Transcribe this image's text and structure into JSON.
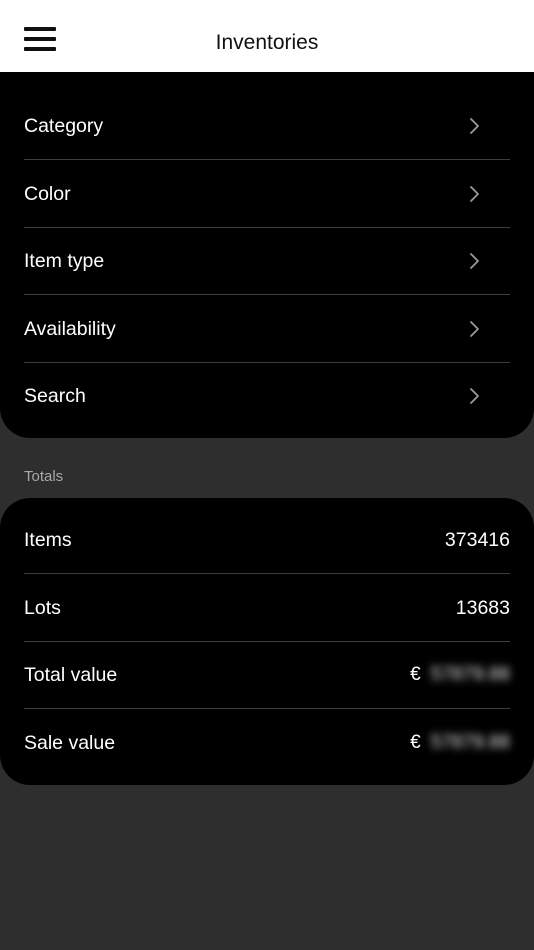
{
  "header": {
    "title": "Inventories",
    "menu_icon": "hamburger-menu-icon"
  },
  "filters": {
    "items": [
      {
        "label": "Category",
        "icon": "chevron-right-icon"
      },
      {
        "label": "Color",
        "icon": "chevron-right-icon"
      },
      {
        "label": "Item type",
        "icon": "chevron-right-icon"
      },
      {
        "label": "Availability",
        "icon": "chevron-right-icon"
      },
      {
        "label": "Search",
        "icon": "chevron-right-icon"
      }
    ]
  },
  "totals": {
    "section_label": "Totals",
    "rows": [
      {
        "label": "Items",
        "value": "373416"
      },
      {
        "label": "Lots",
        "value": "13683"
      },
      {
        "label": "Total value",
        "currency": "€",
        "value": "57879.88"
      },
      {
        "label": "Sale value",
        "currency": "€",
        "value": "57879.88"
      }
    ]
  },
  "colors": {
    "header_bg": "#ffffff",
    "card_bg": "#000000",
    "page_bg": "#2e2e2e",
    "divider": "#3d3d3d",
    "muted_text": "#a8a8a8"
  }
}
